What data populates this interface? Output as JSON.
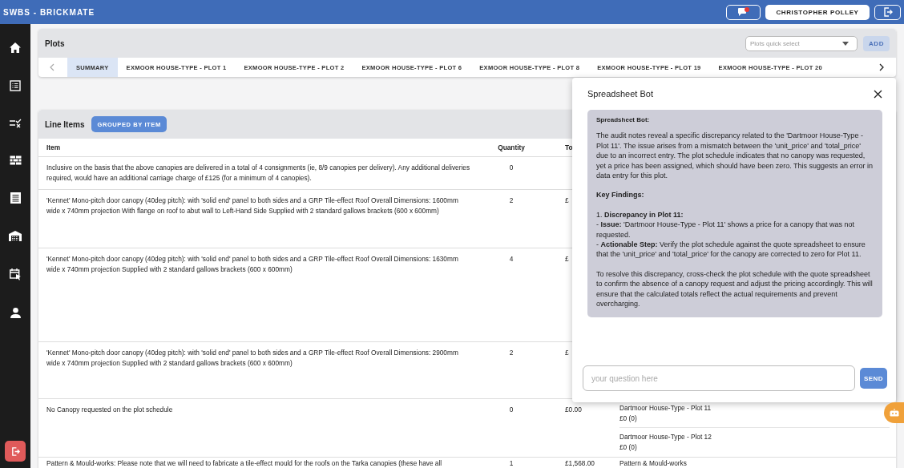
{
  "app": {
    "title": "SWBS - BRICKMATE",
    "user_button": "CHRISTOPHER POLLEY"
  },
  "plots": {
    "title": "Plots",
    "quick_select": {
      "placeholder": "Plots quick select"
    },
    "add_button": "ADD",
    "tabs": [
      {
        "label": "SUMMARY",
        "selected": true
      },
      {
        "label": "EXMOOR HOUSE-TYPE - PLOT 1",
        "selected": false
      },
      {
        "label": "EXMOOR HOUSE-TYPE - PLOT 2",
        "selected": false
      },
      {
        "label": "EXMOOR HOUSE-TYPE - PLOT 6",
        "selected": false
      },
      {
        "label": "EXMOOR HOUSE-TYPE - PLOT 8",
        "selected": false
      },
      {
        "label": "EXMOOR HOUSE-TYPE - PLOT 19",
        "selected": false
      },
      {
        "label": "EXMOOR HOUSE-TYPE - PLOT 20",
        "selected": false
      }
    ]
  },
  "line_items": {
    "title": "Line Items",
    "group_button": "GROUPED BY ITEM",
    "columns": [
      "Item",
      "Quantity",
      "To"
    ],
    "rows": [
      {
        "item": "Inclusive on the basis that the above canopies are delivered in a total of 4 consignments (ie, 8/9 canopies per delivery). Any additional deliveries required, would have an additional carriage charge of £125 (for a minimum of 4 canopies).",
        "quantity": "0"
      },
      {
        "item": "'Kennet' Mono-pitch door canopy (40deg pitch): with 'solid end' panel to both sides and a GRP Tile-effect Roof Overall Dimensions: 1600mm wide x 740mm projection With flange on roof to abut wall to Left-Hand Side Supplied with 2 standard gallows brackets (600 x 600mm)",
        "quantity": "2",
        "total": "£"
      },
      {
        "item": "'Kennet' Mono-pitch door canopy (40deg pitch): with 'solid end' panel to both sides and a GRP Tile-effect Roof Overall Dimensions: 1630mm wide x 740mm projection Supplied with 2 standard gallows brackets (600 x 600mm)",
        "quantity": "4",
        "total": "£"
      },
      {
        "item": "'Kennet' Mono-pitch door canopy (40deg pitch): with 'solid end' panel to both sides and a GRP Tile-effect Roof Overall Dimensions: 2900mm wide x 740mm projection Supplied with 2 standard gallows brackets (600 x 600mm)",
        "quantity": "2",
        "total": "£"
      },
      {
        "item": "No Canopy requested on the plot schedule",
        "quantity": "0",
        "total": "£0.00",
        "breakdown": [
          {
            "plot": "Dartmoor House-Type - Plot 11",
            "amount": "£0 (0)"
          },
          {
            "plot": "Dartmoor House-Type - Plot 12",
            "amount": "£0 (0)"
          }
        ]
      },
      {
        "item": "Pattern & Mould-works: Please note that we will need to fabricate a tile-effect mould for the roofs on the Tarka canopies (these have all",
        "quantity": "1",
        "total": "£1,568.00",
        "breakdown": [
          {
            "plot": "Pattern & Mould-works"
          }
        ]
      }
    ]
  },
  "bot": {
    "title": "Spreadsheet Bot",
    "sender": "Spreadsheet Bot:",
    "blocks": [
      {
        "kind": "text",
        "text": "The audit notes reveal a specific discrepancy related to the 'Dartmoor House-Type - Plot 11'. The issue arises from a mismatch between the 'unit_price' and 'total_price' due to an incorrect entry. The plot schedule indicates that no canopy was requested, yet a price has been assigned, which should have been zero. This suggests an error in data entry for this plot."
      },
      {
        "kind": "heading",
        "text": "Key Findings:"
      },
      {
        "kind": "lines",
        "lines": [
          "1. **Discrepancy in Plot 11:**",
          "- **Issue:** 'Dartmoor House-Type - Plot 11' shows a price for a canopy that was not requested.",
          "- **Actionable Step:** Verify the plot schedule against the quote spreadsheet to ensure that the 'unit_price' and 'total_price' for the canopy are corrected to zero for Plot 11."
        ]
      },
      {
        "kind": "text",
        "text": "To resolve this discrepancy, cross-check the plot schedule with the quote spreadsheet to confirm the absence of a canopy request and adjust the pricing accordingly. This will ensure that the calculated totals reflect the actual requirements and prevent overcharging."
      }
    ],
    "input": {
      "placeholder": "your question here"
    },
    "send_button": "SEND"
  }
}
